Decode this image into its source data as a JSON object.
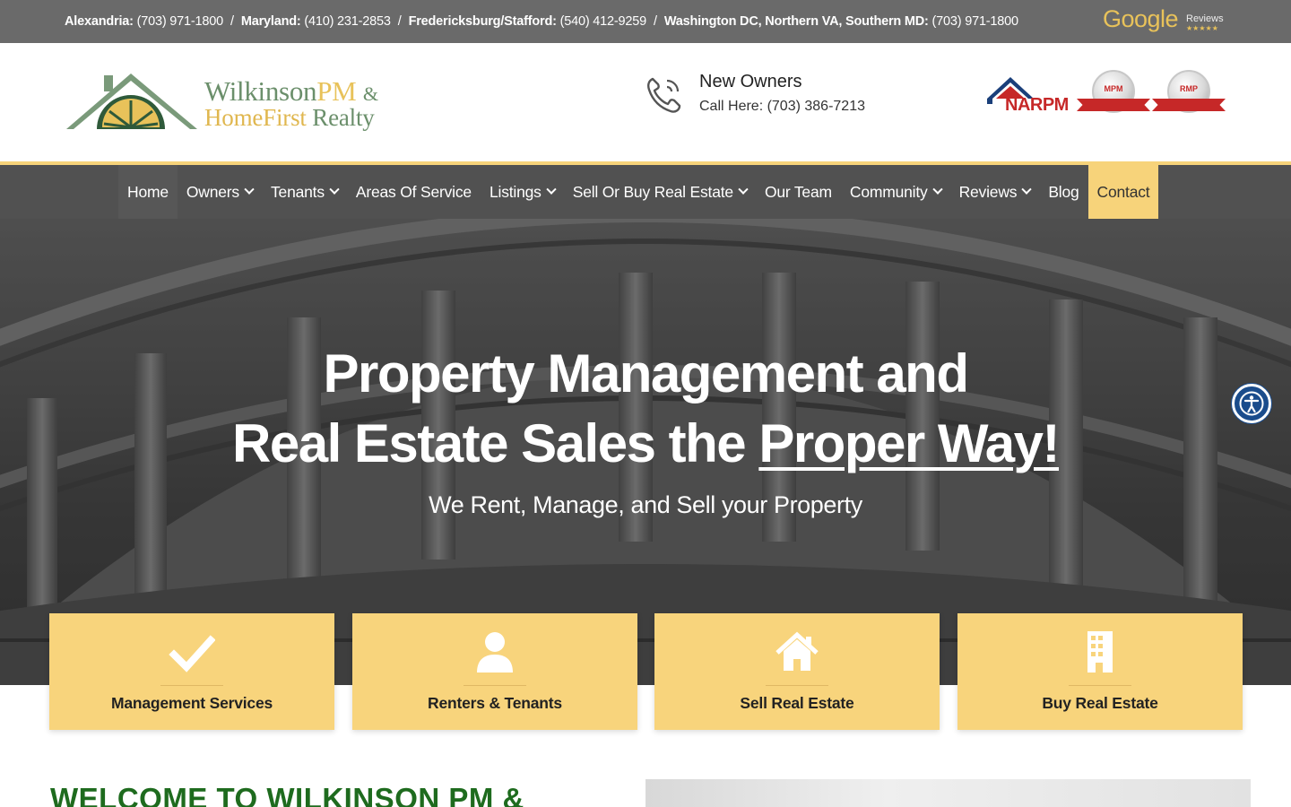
{
  "topbar": {
    "phones": [
      {
        "area": "Alexandria:",
        "number": "(703) 971-1800"
      },
      {
        "area": "Maryland:",
        "number": "(410) 231-2853"
      },
      {
        "area": "Fredericksburg/Stafford:",
        "number": "(540) 412-9259"
      },
      {
        "area": "Washington DC, Northern VA, Southern MD:",
        "number": "(703) 971-1800"
      }
    ],
    "separator": "/",
    "google": {
      "word": "Google",
      "label": "Reviews",
      "stars": "★★★★★"
    }
  },
  "header": {
    "logo": {
      "line1_a": "Wilkinson",
      "line1_b": "PM",
      "line1_amp": "&",
      "line2_a": "HomeFirst",
      "line2_b": "Realty"
    },
    "contact": {
      "title": "New Owners",
      "line": "Call Here: (703) 386-7213"
    },
    "badges": {
      "narpm": "NARPM",
      "seal1": "MPM",
      "seal2": "RMP"
    }
  },
  "nav": {
    "items": [
      {
        "label": "Home",
        "dropdown": false
      },
      {
        "label": "Owners",
        "dropdown": true
      },
      {
        "label": "Tenants",
        "dropdown": true
      },
      {
        "label": "Areas Of Service",
        "dropdown": false
      },
      {
        "label": "Listings",
        "dropdown": true
      },
      {
        "label": "Sell Or Buy Real Estate",
        "dropdown": true
      },
      {
        "label": "Our Team",
        "dropdown": false
      },
      {
        "label": "Community",
        "dropdown": true
      },
      {
        "label": "Reviews",
        "dropdown": true
      },
      {
        "label": "Blog",
        "dropdown": false
      },
      {
        "label": "Contact",
        "dropdown": false
      }
    ],
    "active": "Home"
  },
  "hero": {
    "title_line1": "Property Management and",
    "title_line2_a": "Real Estate Sales the ",
    "title_line2_b": "Proper Way!",
    "subtitle": "We Rent, Manage, and Sell your Property"
  },
  "cards": [
    {
      "label": "Management Services",
      "icon": "checkmark-icon"
    },
    {
      "label": "Renters & Tenants",
      "icon": "person-icon"
    },
    {
      "label": "Sell Real Estate",
      "icon": "home-icon"
    },
    {
      "label": "Buy Real Estate",
      "icon": "building-icon"
    }
  ],
  "welcome": {
    "heading": "WELCOME TO WILKINSON PM &"
  },
  "colors": {
    "gold": "#f8d47c",
    "topbar": "#6a6a6a",
    "nav": "#464646",
    "heading_green": "#1e6b1e",
    "accessibility_blue": "#1a4c8c"
  }
}
